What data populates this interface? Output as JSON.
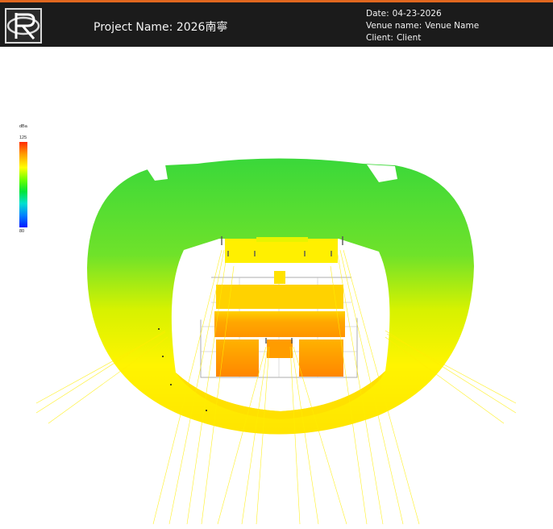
{
  "header": {
    "project_label": "Project Name:",
    "project_value": "2026南寧",
    "date_label": "Date:",
    "date_value": "04-23-2026",
    "venue_label": "Venue name:",
    "venue_value": "Venue Name",
    "client_label": "Client:",
    "client_value": "Client"
  },
  "legend": {
    "unit": "dBa",
    "max": "125",
    "min": "80"
  },
  "colors": {
    "header_bg": "#1b1b1b",
    "accent": "#e0671f",
    "high": "#ff2a00",
    "mid": "#ffff00",
    "low": "#0018ff"
  }
}
